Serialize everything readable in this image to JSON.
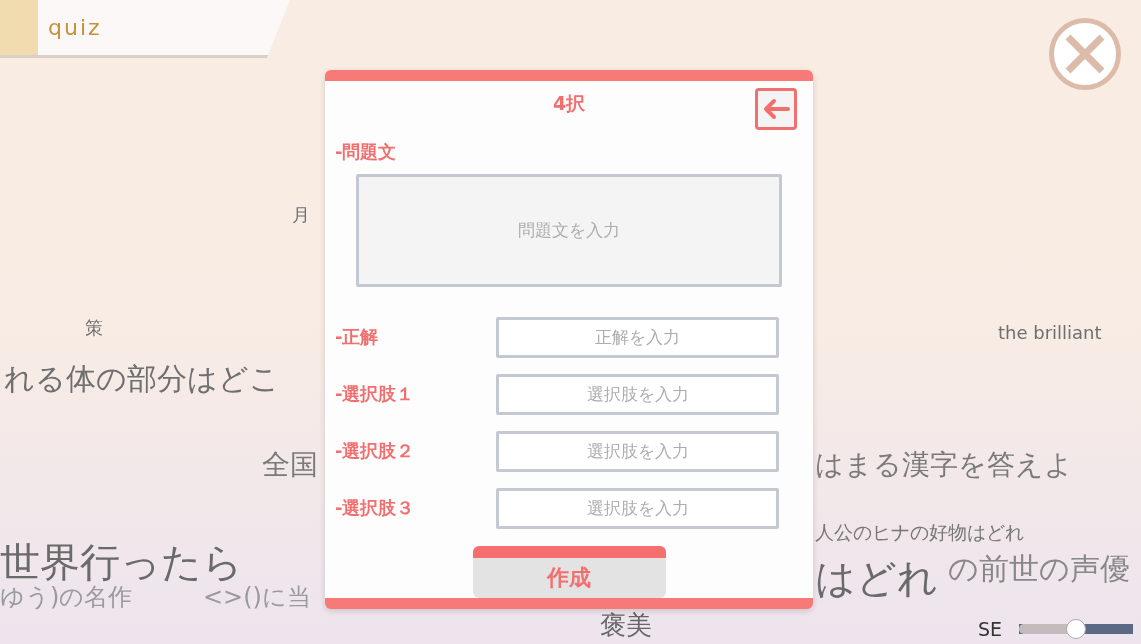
{
  "header": {
    "title": "quiz"
  },
  "background_words": [
    {
      "text": "月"
    },
    {
      "text": "策"
    },
    {
      "text": "the brilliant"
    },
    {
      "text": "れる体の部分はどこ"
    },
    {
      "text": "全国"
    },
    {
      "text": "はまる漢字を答えよ"
    },
    {
      "text": "人公のヒナの好物はどれ"
    },
    {
      "text": "世界行ったら"
    },
    {
      "text": "はどれ"
    },
    {
      "text": "の前世の声優"
    },
    {
      "text": "ゆう)の名作"
    },
    {
      "text": "<>()に当"
    },
    {
      "text": "褒美"
    }
  ],
  "dialog": {
    "title": "4択",
    "question": {
      "label": "-問題文",
      "placeholder": "問題文を入力"
    },
    "answers": [
      {
        "label": "-正解",
        "placeholder": "正解を入力"
      },
      {
        "label": "-選択肢１",
        "placeholder": "選択肢を入力"
      },
      {
        "label": "-選択肢２",
        "placeholder": "選択肢を入力"
      },
      {
        "label": "-選択肢３",
        "placeholder": "選択肢を入力"
      }
    ],
    "submit": "作成"
  },
  "volume": {
    "label": "SE",
    "level": 0.5
  }
}
